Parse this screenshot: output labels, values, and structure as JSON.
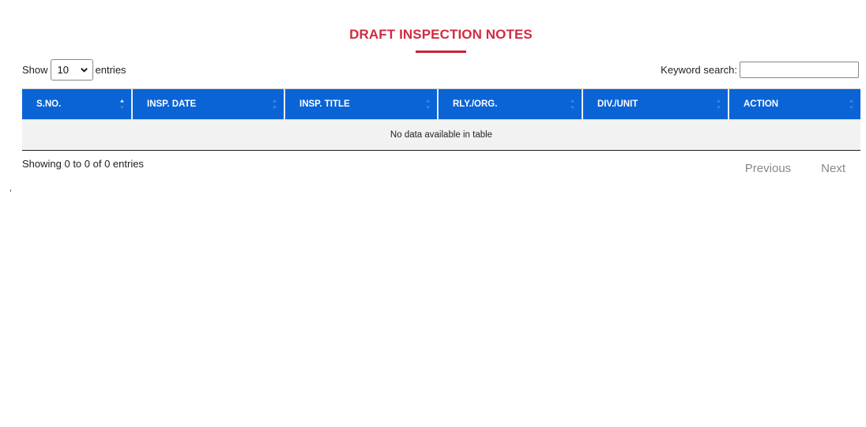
{
  "page": {
    "title": "DRAFT INSPECTION NOTES"
  },
  "length_control": {
    "show_label": "Show",
    "selected": "10",
    "entries_label": "entries"
  },
  "search": {
    "label": "Keyword search:",
    "value": ""
  },
  "table": {
    "columns": [
      "S.NO.",
      "INSP. DATE",
      "INSP. TITLE",
      "RLY./ORG.",
      "DIV./UNIT",
      "ACTION"
    ],
    "empty_message": "No data available in table"
  },
  "info": "Showing 0 to 0 of 0 entries",
  "pagination": {
    "previous": "Previous",
    "next": "Next"
  },
  "colors": {
    "title": "#d12b3f",
    "header_bg": "#0a64d6"
  }
}
